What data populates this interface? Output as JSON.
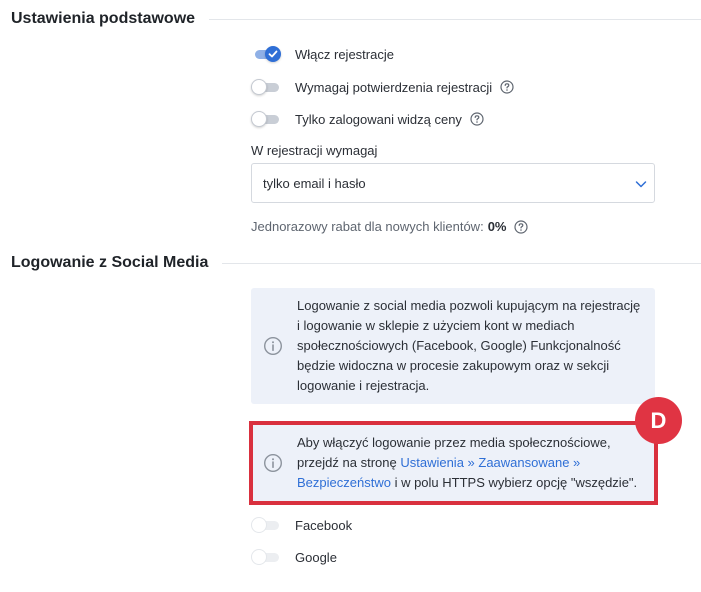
{
  "basic_settings": {
    "title": "Ustawienia podstawowe",
    "toggles": [
      {
        "label": "Włącz rejestracje",
        "on": true,
        "help": false
      },
      {
        "label": "Wymagaj potwierdzenia rejestracji",
        "on": false,
        "help": true
      },
      {
        "label": "Tylko zalogowani widzą ceny",
        "on": false,
        "help": true
      }
    ],
    "registration_require_label": "W rejestracji wymagaj",
    "registration_require_value": "tylko email i hasło",
    "discount_label": "Jednorazowy rabat dla nowych klientów:",
    "discount_value": "0%"
  },
  "social_media": {
    "title": "Logowanie z Social Media",
    "info_text": "Logowanie z social media pozwoli kupującym na rejestrację i logowanie w sklepie z użyciem kont w mediach społecznościowych (Facebook, Google) Funkcjonalność będzie widoczna w procesie zakupowym oraz w sekcji logowanie i rejestracja.",
    "https_notice": {
      "prefix": "Aby włączyć logowanie przez media społecznościowe, przejdź na stronę ",
      "link": "Ustawienia » Zaawansowane » Bezpieczeństwo",
      "suffix": " i w polu HTTPS wybierz opcję \"wszędzie\"."
    },
    "toggles": [
      {
        "label": "Facebook",
        "on": false
      },
      {
        "label": "Google",
        "on": false
      }
    ],
    "badge": "D"
  },
  "colors": {
    "accent": "#2f6fd6",
    "highlight": "#d9303e",
    "info_bg": "#edf1f9"
  }
}
